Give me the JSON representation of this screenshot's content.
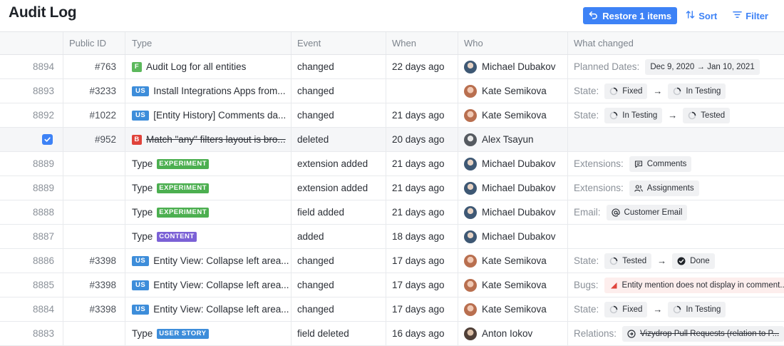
{
  "page": {
    "title": "Audit Log"
  },
  "toolbar": {
    "restore_label": "Restore 1 items",
    "sort_label": "Sort",
    "filter_label": "Filter"
  },
  "columns": {
    "public_id": "Public ID",
    "type": "Type",
    "event": "Event",
    "when": "When",
    "who": "Who",
    "what": "What changed"
  },
  "colors": {
    "accent": "#3d82f6",
    "feature": "#5cb85c",
    "userstory": "#3d8dda",
    "bug": "#e0433b",
    "experiment": "#4caf50",
    "content": "#7b61d6"
  },
  "rows": [
    {
      "num": "8894",
      "pid": "#763",
      "type_badge": "F",
      "type_kind": "feature",
      "type_title": "Audit Log for all entities",
      "event": "changed",
      "when": "22 days ago",
      "who": "Michael Dubakov",
      "avatar": "md",
      "what_label": "Planned Dates:",
      "chip1": "Dec 9, 2020 → Jan 10, 2021"
    },
    {
      "num": "8893",
      "pid": "#3233",
      "type_badge": "US",
      "type_kind": "userstory",
      "type_title": "Install Integrations Apps from...",
      "event": "changed",
      "when": "",
      "who": "Kate Semikova",
      "avatar": "ks",
      "what_label": "State:",
      "chip1": "Fixed",
      "chip1_icon": "progress-icon",
      "chip2": "In Testing",
      "chip2_icon": "progress-icon"
    },
    {
      "num": "8892",
      "pid": "#1022",
      "type_badge": "US",
      "type_kind": "userstory",
      "type_title": "[Entity History] Comments da...",
      "event": "changed",
      "when": "21 days ago",
      "who": "Kate Semikova",
      "avatar": "ks",
      "what_label": "State:",
      "chip1": "In Testing",
      "chip1_icon": "progress-icon",
      "chip2": "Tested",
      "chip2_icon": "progress-icon"
    },
    {
      "num": "",
      "pid": "#952",
      "type_badge": "B",
      "type_kind": "bug",
      "type_title": "Match \"any\" filters layout is bro...",
      "event": "deleted",
      "when": "20 days ago",
      "who": "Alex Tsayun",
      "avatar": "at",
      "what_label": ""
    },
    {
      "num": "8889",
      "pid": "",
      "type_word": "Type",
      "type_badge": "EXPERIMENT",
      "type_kind": "experiment",
      "event": "extension added",
      "when": "21 days ago",
      "who": "Michael Dubakov",
      "avatar": "md",
      "what_label": "Extensions:",
      "chip1": "Comments",
      "chip1_icon": "comment-icon"
    },
    {
      "num": "8889",
      "pid": "",
      "type_word": "Type",
      "type_badge": "EXPERIMENT",
      "type_kind": "experiment",
      "event": "extension added",
      "when": "21 days ago",
      "who": "Michael Dubakov",
      "avatar": "md",
      "what_label": "Extensions:",
      "chip1": "Assignments",
      "chip1_icon": "people-icon"
    },
    {
      "num": "8888",
      "pid": "",
      "type_word": "Type",
      "type_badge": "EXPERIMENT",
      "type_kind": "experiment",
      "event": "field added",
      "when": "21 days ago",
      "who": "Michael Dubakov",
      "avatar": "md",
      "what_label": "Email:",
      "chip1": "Customer Email",
      "chip1_icon": "at-icon"
    },
    {
      "num": "8887",
      "pid": "",
      "type_word": "Type",
      "type_badge": "CONTENT",
      "type_kind": "content",
      "event": "added",
      "when": "18 days ago",
      "who": "Michael Dubakov",
      "avatar": "md",
      "what_label": ""
    },
    {
      "num": "8886",
      "pid": "#3398",
      "type_badge": "US",
      "type_kind": "userstory",
      "type_title": "Entity View: Collapse left area...",
      "event": "changed",
      "when": "17 days ago",
      "who": "Kate Semikova",
      "avatar": "ks",
      "what_label": "State:",
      "chip1": "Tested",
      "chip1_icon": "progress-icon",
      "chip2": "Done",
      "chip2_icon": "done-icon"
    },
    {
      "num": "8885",
      "pid": "#3398",
      "type_badge": "US",
      "type_kind": "userstory",
      "type_title": "Entity View: Collapse left area...",
      "event": "changed",
      "when": "17 days ago",
      "who": "Kate Semikova",
      "avatar": "ks",
      "what_label": "Bugs:",
      "chip1": "Entity mention does not display in comment...",
      "chip1_icon": "bug-icon",
      "chip1_danger": true
    },
    {
      "num": "8884",
      "pid": "#3398",
      "type_badge": "US",
      "type_kind": "userstory",
      "type_title": "Entity View: Collapse left area...",
      "event": "changed",
      "when": "17 days ago",
      "who": "Kate Semikova",
      "avatar": "ks",
      "what_label": "State:",
      "chip1": "Fixed",
      "chip1_icon": "progress-icon",
      "chip2": "In Testing",
      "chip2_icon": "progress-icon"
    },
    {
      "num": "8883",
      "pid": "",
      "type_word": "Type",
      "type_badge": "USER STORY",
      "type_kind": "userstory",
      "event": "field deleted",
      "when": "16 days ago",
      "who": "Anton Iokov",
      "avatar": "ai",
      "what_label": "Relations:",
      "chip1": "Vizydrop Pull Requests (relation to P...",
      "chip1_icon": "relation-icon",
      "chip1_strike": true
    }
  ]
}
